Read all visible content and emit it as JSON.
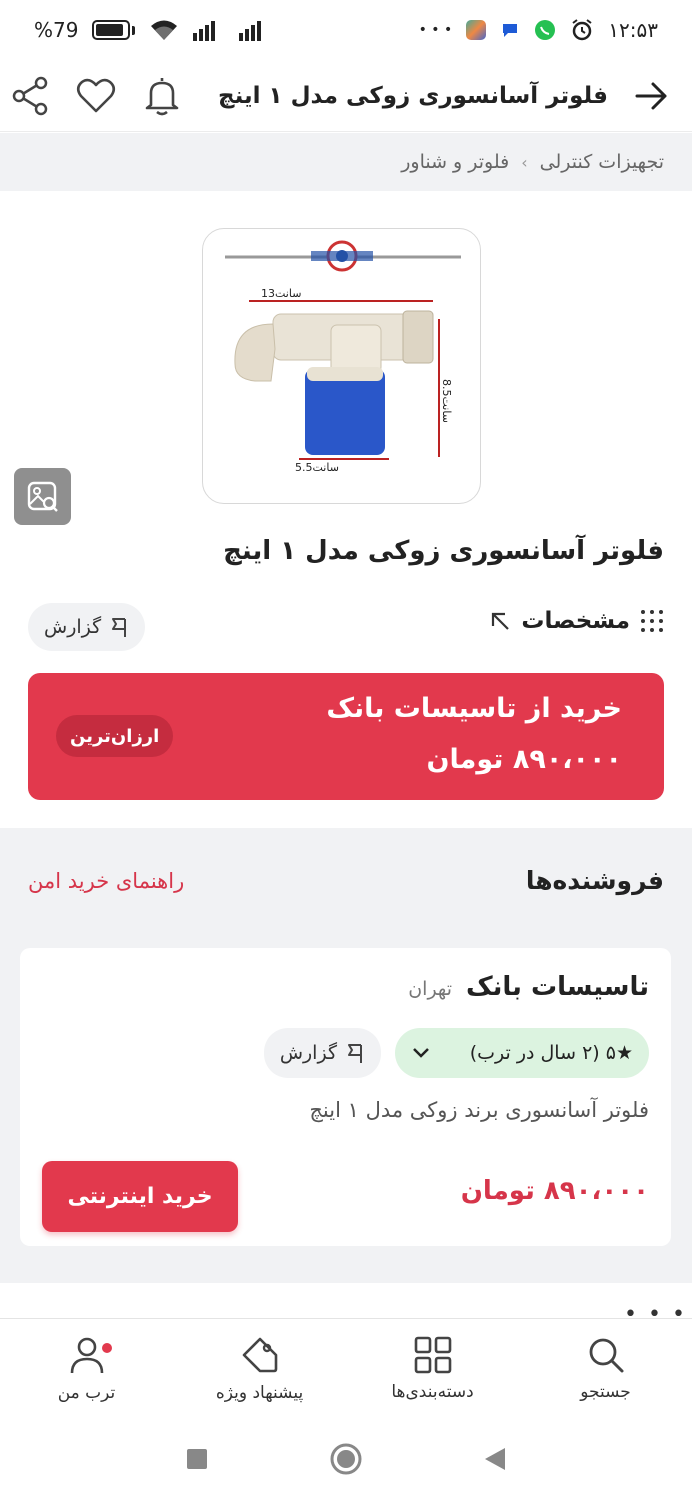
{
  "status_bar": {
    "battery": "79",
    "battery_suffix": "%",
    "time": "۱۲:۵۳",
    "more": "• • •"
  },
  "header": {
    "title": "فلوتر آسانسوری زوکی مدل ۱ اینچ"
  },
  "breadcrumb": {
    "items": [
      "تجهیزات کنترلی",
      "فلوتر و شناور"
    ],
    "separator": "›"
  },
  "product": {
    "image_labels": {
      "width": "سانت13",
      "height": "سانت8.5",
      "base": "سانت5.5"
    },
    "title": "فلوتر آسانسوری زوکی مدل ۱ اینچ",
    "specs_label": "مشخصات",
    "report_label": "گزارش"
  },
  "buy_banner": {
    "line1": "خرید از تاسیسات بانک",
    "line2": "۸۹۰،۰۰۰ تومان",
    "badge": "ارزان‌ترین"
  },
  "sellers": {
    "title": "فروشنده‌ها",
    "safe_guide": "راهنمای خرید امن",
    "cards": [
      {
        "name": "تاسیسات بانک",
        "city": "تهران",
        "rating": "★۵ (۲ سال در ترب)",
        "report": "گزارش",
        "description": "فلوتر آسانسوری برند زوکی مدل ۱ اینچ",
        "price": "۸۹۰،۰۰۰ تومان",
        "buy_label": "خرید اینترنتی"
      }
    ]
  },
  "more": "• • •",
  "bottom_nav": {
    "items": [
      {
        "label": "جستجو"
      },
      {
        "label": "دسته‌بندی‌ها"
      },
      {
        "label": "پیشنهاد ویژه"
      },
      {
        "label": "ترب من"
      }
    ]
  },
  "colors": {
    "accent": "#e2394d",
    "rating_bg": "#dcf3e0",
    "section_bg": "#f1f2f4"
  }
}
